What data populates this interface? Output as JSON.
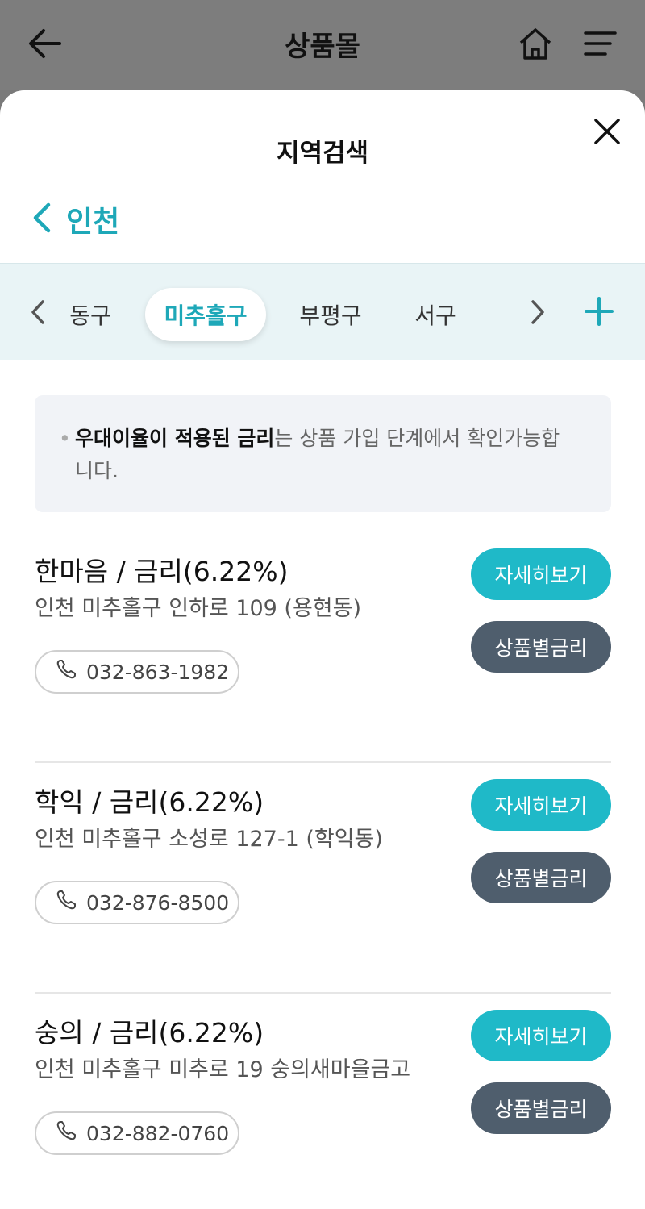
{
  "header": {
    "title": "상품몰",
    "icons": [
      "arrow-left-icon",
      "home-icon",
      "menu-icon"
    ]
  },
  "sheet": {
    "title": "지역검색"
  },
  "region": {
    "label": "인천"
  },
  "tabs": [
    {
      "label": "동구",
      "selected": false
    },
    {
      "label": "미추홀구",
      "selected": true
    },
    {
      "label": "부평구",
      "selected": false
    },
    {
      "label": "서구",
      "selected": false
    }
  ],
  "notice": {
    "bold": "우대이율이 적용된 금리",
    "rest": "는 상품 가입 단계에서 확인가능합니다."
  },
  "items": [
    {
      "name": "한마음 / 금리(6.22%)",
      "address": "인천 미추홀구 인하로 109 (용현동)",
      "phone": "032-863-1982",
      "detail_label": "자세히보기",
      "rate_label": "상품별금리"
    },
    {
      "name": "학익 / 금리(6.22%)",
      "address": "인천 미추홀구 소성로 127-1 (학익동)",
      "phone": "032-876-8500",
      "detail_label": "자세히보기",
      "rate_label": "상품별금리"
    },
    {
      "name": "숭의 / 금리(6.22%)",
      "address": "인천 미추홀구 미추로 19 숭의새마을금고",
      "phone": "032-882-0760",
      "detail_label": "자세히보기",
      "rate_label": "상품별금리"
    }
  ],
  "colors": {
    "accent": "#1fb9c8",
    "dark_button": "#4f5e6d",
    "tab_bg": "#e9f4f6"
  }
}
